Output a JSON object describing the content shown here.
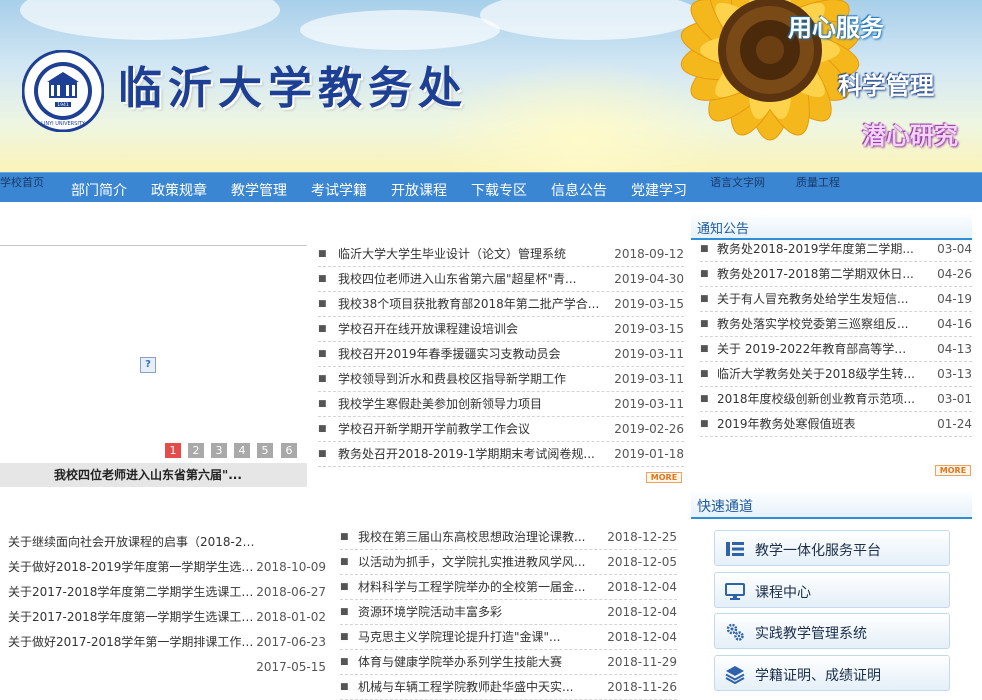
{
  "header": {
    "site_title": "临沂大学教务处",
    "slogans": [
      "用心服务",
      "科学管理",
      "潜心研究"
    ],
    "seal_year": "1941",
    "seal_text": "LINYI UNIVERSITY"
  },
  "nav": {
    "home": "学校首页",
    "items": [
      "部门简介",
      "政策规章",
      "教学管理",
      "考试学籍",
      "开放课程",
      "下载专区",
      "信息公告",
      "党建学习"
    ],
    "extra": [
      "语言文字网",
      "质量工程"
    ]
  },
  "slideshow": {
    "numbers": [
      "1",
      "2",
      "3",
      "4",
      "5",
      "6"
    ],
    "active": 1,
    "caption": "我校四位老师进入山东省第六届\"..."
  },
  "news": [
    {
      "title": "临沂大学大学生毕业设计（论文）管理系统",
      "date": "2018-09-12"
    },
    {
      "title": "我校四位老师进入山东省第六届\"超星杯\"青...",
      "date": "2019-04-30"
    },
    {
      "title": "我校38个项目获批教育部2018年第二批产学合...",
      "date": "2019-03-15"
    },
    {
      "title": "学校召开在线开放课程建设培训会",
      "date": "2019-03-15"
    },
    {
      "title": "我校召开2019年春季援疆实习支教动员会",
      "date": "2019-03-11"
    },
    {
      "title": "学校领导到沂水和费县校区指导新学期工作",
      "date": "2019-03-11"
    },
    {
      "title": "我校学生寒假赴美参加创新领导力项目",
      "date": "2019-03-11"
    },
    {
      "title": "学校召开新学期开学前教学工作会议",
      "date": "2019-02-26"
    },
    {
      "title": "教务处召开2018-2019-1学期期末考试阅卷规...",
      "date": "2019-01-18"
    }
  ],
  "notices": {
    "heading": "通知公告",
    "items": [
      {
        "title": "教务处2018-2019学年度第二学期...",
        "date": "03-04"
      },
      {
        "title": "教务处2017-2018第二学期双休日...",
        "date": "04-26"
      },
      {
        "title": "关于有人冒充教务处给学生发短信...",
        "date": "04-19"
      },
      {
        "title": "教务处落实学校党委第三巡察组反...",
        "date": "04-16"
      },
      {
        "title": "关于 2019-2022年教育部高等学校...",
        "date": "04-13"
      },
      {
        "title": "临沂大学教务处关于2018级学生转...",
        "date": "03-13"
      },
      {
        "title": "2018年度校级创新创业教育示范项...",
        "date": "03-01"
      },
      {
        "title": "2019年教务处寒假值班表",
        "date": "01-24"
      }
    ]
  },
  "more_label": "MORE",
  "courses": [
    {
      "title": "关于继续面向社会开放课程的启事（2018-201...",
      "date": ""
    },
    {
      "title": "关于做好2018-2019学年度第一学期学生选课...",
      "date": "2018-10-09"
    },
    {
      "title": "关于2017-2018学年度第二学期学生选课工作...",
      "date": "2018-06-27"
    },
    {
      "title": "关于2017-2018学年度第一学期学生选课工作...",
      "date": "2018-01-02"
    },
    {
      "title": "关于做好2017-2018学年第一学期排课工作的...",
      "date": "2017-06-23"
    },
    {
      "title": "",
      "date": "2017-05-15"
    }
  ],
  "college_news": [
    {
      "title": "我校在第三届山东高校思想政治理论课教...",
      "date": "2018-12-25"
    },
    {
      "title": "以活动为抓手，文学院扎实推进教风学风...",
      "date": "2018-12-05"
    },
    {
      "title": "材料科学与工程学院举办的全校第一届金...",
      "date": "2018-12-04"
    },
    {
      "title": "资源环境学院活动丰富多彩",
      "date": "2018-12-04"
    },
    {
      "title": "马克思主义学院理论提升打造\"金课\"...",
      "date": "2018-12-04"
    },
    {
      "title": "体育与健康学院举办系列学生技能大赛",
      "date": "2018-11-29"
    },
    {
      "title": "机械与车辆工程学院教师赴华盛中天实...",
      "date": "2018-11-26"
    }
  ],
  "quick": {
    "heading": "快速通道",
    "items": [
      {
        "label": "教学一体化服务平台",
        "icon": "list-icon"
      },
      {
        "label": "课程中心",
        "icon": "monitor-icon"
      },
      {
        "label": "实践教学管理系统",
        "icon": "gears-icon"
      },
      {
        "label": "学籍证明、成绩证明",
        "icon": "layers-icon"
      }
    ]
  },
  "colors": {
    "nav_bg": "#3b86d2",
    "title_blue": "#1d3f94",
    "accent_red": "#e44b4b",
    "sidebar_border": "#2f8fd6"
  }
}
